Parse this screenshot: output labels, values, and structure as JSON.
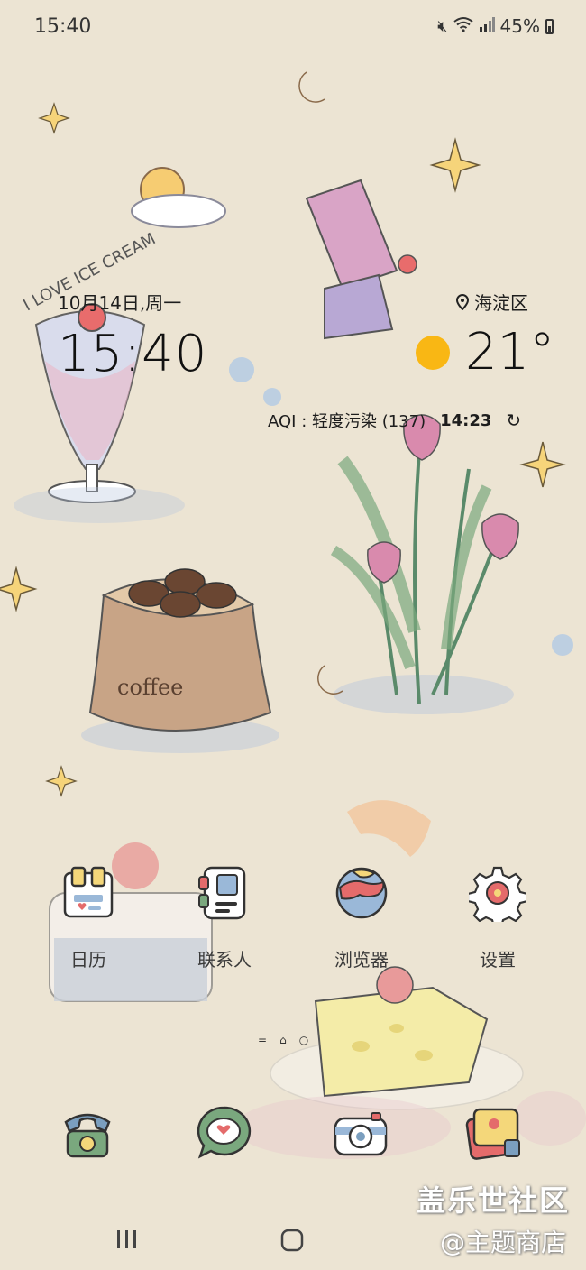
{
  "status_bar": {
    "time": "15:40",
    "battery": "45%"
  },
  "widget": {
    "date": "10月14日,周一",
    "clock": "15:40",
    "location": "海淀区",
    "temperature": "21°",
    "aqi_label": "AQI : 轻度污染 (137)",
    "updated_time": "14:23"
  },
  "apps": [
    {
      "label": "日历",
      "icon": "calendar-icon"
    },
    {
      "label": "联系人",
      "icon": "contacts-icon"
    },
    {
      "label": "浏览器",
      "icon": "browser-icon"
    },
    {
      "label": "设置",
      "icon": "settings-icon"
    }
  ],
  "dock": [
    "phone-icon",
    "messages-icon",
    "camera-icon",
    "gallery-icon"
  ],
  "watermark": {
    "line1": "盖乐世社区",
    "line2": "@主题商店"
  },
  "colors": {
    "background": "#ece4d3",
    "sun": "#f9b714"
  }
}
